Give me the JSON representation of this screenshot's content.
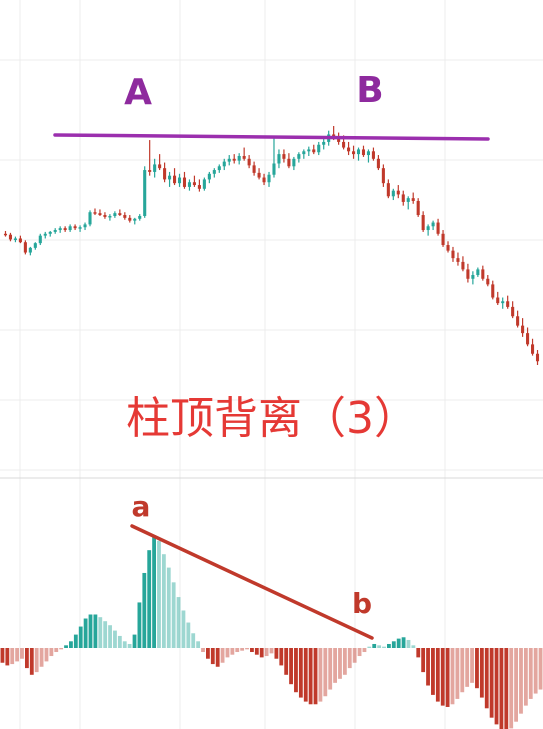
{
  "chart_data": [
    {
      "type": "candlestick",
      "annotations": {
        "peak_a_label": "A",
        "peak_b_label": "B",
        "resistance_line_color": "#9b2fae",
        "label_color": "#8e2a9e"
      },
      "colors": {
        "up": "#26a69a",
        "down": "#c0392b"
      },
      "grid": true,
      "ohlc": [
        [
          0.6,
          0.63,
          0.57,
          0.59
        ],
        [
          0.59,
          0.61,
          0.52,
          0.54
        ],
        [
          0.54,
          0.57,
          0.51,
          0.55
        ],
        [
          0.55,
          0.58,
          0.5,
          0.51
        ],
        [
          0.51,
          0.53,
          0.38,
          0.4
        ],
        [
          0.4,
          0.46,
          0.37,
          0.45
        ],
        [
          0.45,
          0.51,
          0.43,
          0.5
        ],
        [
          0.5,
          0.6,
          0.48,
          0.58
        ],
        [
          0.58,
          0.62,
          0.55,
          0.6
        ],
        [
          0.6,
          0.63,
          0.57,
          0.62
        ],
        [
          0.62,
          0.66,
          0.6,
          0.64
        ],
        [
          0.64,
          0.68,
          0.61,
          0.66
        ],
        [
          0.66,
          0.68,
          0.62,
          0.64
        ],
        [
          0.64,
          0.7,
          0.62,
          0.68
        ],
        [
          0.68,
          0.7,
          0.64,
          0.66
        ],
        [
          0.66,
          0.69,
          0.62,
          0.67
        ],
        [
          0.67,
          0.72,
          0.64,
          0.7
        ],
        [
          0.7,
          0.85,
          0.68,
          0.83
        ],
        [
          0.83,
          0.87,
          0.8,
          0.82
        ],
        [
          0.82,
          0.86,
          0.79,
          0.8
        ],
        [
          0.8,
          0.83,
          0.76,
          0.78
        ],
        [
          0.78,
          0.81,
          0.74,
          0.79
        ],
        [
          0.79,
          0.84,
          0.77,
          0.82
        ],
        [
          0.82,
          0.86,
          0.79,
          0.8
        ],
        [
          0.8,
          0.83,
          0.75,
          0.77
        ],
        [
          0.77,
          0.8,
          0.72,
          0.74
        ],
        [
          0.74,
          0.77,
          0.7,
          0.76
        ],
        [
          0.76,
          0.81,
          0.74,
          0.79
        ],
        [
          0.79,
          1.32,
          0.77,
          1.28
        ],
        [
          1.28,
          1.6,
          1.22,
          1.26
        ],
        [
          1.26,
          1.4,
          1.2,
          1.34
        ],
        [
          1.34,
          1.45,
          1.28,
          1.3
        ],
        [
          1.3,
          1.36,
          1.15,
          1.18
        ],
        [
          1.18,
          1.26,
          1.1,
          1.22
        ],
        [
          1.22,
          1.3,
          1.12,
          1.14
        ],
        [
          1.14,
          1.24,
          1.1,
          1.2
        ],
        [
          1.2,
          1.26,
          1.08,
          1.1
        ],
        [
          1.1,
          1.18,
          1.06,
          1.15
        ],
        [
          1.15,
          1.22,
          1.1,
          1.12
        ],
        [
          1.12,
          1.18,
          1.05,
          1.08
        ],
        [
          1.08,
          1.2,
          1.06,
          1.18
        ],
        [
          1.18,
          1.26,
          1.14,
          1.24
        ],
        [
          1.24,
          1.3,
          1.2,
          1.28
        ],
        [
          1.28,
          1.34,
          1.25,
          1.32
        ],
        [
          1.32,
          1.4,
          1.28,
          1.37
        ],
        [
          1.37,
          1.44,
          1.33,
          1.4
        ],
        [
          1.4,
          1.45,
          1.35,
          1.38
        ],
        [
          1.38,
          1.46,
          1.34,
          1.43
        ],
        [
          1.43,
          1.52,
          1.38,
          1.4
        ],
        [
          1.4,
          1.44,
          1.3,
          1.33
        ],
        [
          1.33,
          1.37,
          1.22,
          1.25
        ],
        [
          1.25,
          1.3,
          1.18,
          1.2
        ],
        [
          1.2,
          1.24,
          1.12,
          1.15
        ],
        [
          1.15,
          1.26,
          1.1,
          1.23
        ],
        [
          1.23,
          1.62,
          1.2,
          1.35
        ],
        [
          1.35,
          1.5,
          1.3,
          1.45
        ],
        [
          1.45,
          1.5,
          1.36,
          1.4
        ],
        [
          1.4,
          1.46,
          1.3,
          1.32
        ],
        [
          1.32,
          1.42,
          1.28,
          1.4
        ],
        [
          1.4,
          1.47,
          1.36,
          1.45
        ],
        [
          1.45,
          1.5,
          1.4,
          1.48
        ],
        [
          1.48,
          1.53,
          1.43,
          1.5
        ],
        [
          1.5,
          1.55,
          1.45,
          1.47
        ],
        [
          1.47,
          1.58,
          1.44,
          1.55
        ],
        [
          1.55,
          1.62,
          1.5,
          1.58
        ],
        [
          1.58,
          1.7,
          1.54,
          1.66
        ],
        [
          1.66,
          1.75,
          1.6,
          1.62
        ],
        [
          1.62,
          1.68,
          1.55,
          1.58
        ],
        [
          1.58,
          1.65,
          1.5,
          1.52
        ],
        [
          1.52,
          1.58,
          1.44,
          1.48
        ],
        [
          1.48,
          1.54,
          1.4,
          1.45
        ],
        [
          1.45,
          1.52,
          1.38,
          1.5
        ],
        [
          1.5,
          1.54,
          1.42,
          1.44
        ],
        [
          1.44,
          1.5,
          1.36,
          1.48
        ],
        [
          1.48,
          1.52,
          1.38,
          1.4
        ],
        [
          1.4,
          1.44,
          1.28,
          1.3
        ],
        [
          1.3,
          1.34,
          1.1,
          1.14
        ],
        [
          1.14,
          1.18,
          0.98,
          1.0
        ],
        [
          1.0,
          1.08,
          0.96,
          1.06
        ],
        [
          1.06,
          1.12,
          0.98,
          1.02
        ],
        [
          1.02,
          1.06,
          0.9,
          0.94
        ],
        [
          0.94,
          1.0,
          0.86,
          0.98
        ],
        [
          0.98,
          1.04,
          0.92,
          0.95
        ],
        [
          0.95,
          0.98,
          0.78,
          0.8
        ],
        [
          0.8,
          0.84,
          0.62,
          0.64
        ],
        [
          0.64,
          0.7,
          0.58,
          0.68
        ],
        [
          0.68,
          0.74,
          0.64,
          0.72
        ],
        [
          0.72,
          0.76,
          0.58,
          0.6
        ],
        [
          0.6,
          0.64,
          0.46,
          0.48
        ],
        [
          0.48,
          0.52,
          0.4,
          0.42
        ],
        [
          0.42,
          0.46,
          0.3,
          0.34
        ],
        [
          0.34,
          0.4,
          0.26,
          0.3
        ],
        [
          0.3,
          0.36,
          0.2,
          0.22
        ],
        [
          0.22,
          0.28,
          0.08,
          0.12
        ],
        [
          0.12,
          0.2,
          0.06,
          0.16
        ],
        [
          0.16,
          0.24,
          0.14,
          0.22
        ],
        [
          0.22,
          0.26,
          0.1,
          0.12
        ],
        [
          0.12,
          0.16,
          0.04,
          0.06
        ],
        [
          0.06,
          0.1,
          -0.1,
          -0.08
        ],
        [
          -0.08,
          -0.02,
          -0.16,
          -0.14
        ],
        [
          -0.14,
          -0.08,
          -0.2,
          -0.12
        ],
        [
          -0.12,
          -0.06,
          -0.2,
          -0.18
        ],
        [
          -0.18,
          -0.12,
          -0.3,
          -0.28
        ],
        [
          -0.28,
          -0.22,
          -0.4,
          -0.38
        ],
        [
          -0.38,
          -0.3,
          -0.5,
          -0.46
        ],
        [
          -0.46,
          -0.4,
          -0.6,
          -0.58
        ],
        [
          -0.58,
          -0.52,
          -0.7,
          -0.68
        ],
        [
          -0.68,
          -0.64,
          -0.8,
          -0.76
        ]
      ]
    },
    {
      "type": "bar",
      "subtype": "macd-histogram",
      "annotations": {
        "peak_a_label": "a",
        "peak_b_label": "b",
        "divergence_line_color": "#c0392b"
      },
      "colors": {
        "positive": "#26a69a",
        "negative": "#c0392b"
      },
      "grid": true,
      "values": [
        -0.22,
        -0.26,
        -0.24,
        -0.2,
        -0.16,
        -0.3,
        -0.4,
        -0.36,
        -0.28,
        -0.2,
        -0.12,
        -0.06,
        -0.02,
        0.04,
        0.1,
        0.2,
        0.32,
        0.44,
        0.5,
        0.5,
        0.46,
        0.4,
        0.34,
        0.26,
        0.18,
        0.1,
        0.06,
        0.2,
        0.68,
        1.12,
        1.46,
        1.68,
        1.6,
        1.4,
        1.2,
        0.98,
        0.76,
        0.56,
        0.38,
        0.22,
        0.1,
        -0.06,
        -0.16,
        -0.24,
        -0.28,
        -0.22,
        -0.14,
        -0.1,
        -0.06,
        -0.04,
        -0.02,
        -0.06,
        -0.1,
        -0.14,
        -0.12,
        -0.08,
        -0.16,
        -0.26,
        -0.4,
        -0.54,
        -0.66,
        -0.74,
        -0.8,
        -0.84,
        -0.84,
        -0.8,
        -0.72,
        -0.62,
        -0.52,
        -0.46,
        -0.4,
        -0.3,
        -0.22,
        -0.12,
        -0.06,
        0.02,
        0.06,
        0.04,
        0.02,
        0.06,
        0.1,
        0.14,
        0.16,
        0.12,
        0.04,
        -0.14,
        -0.36,
        -0.56,
        -0.7,
        -0.8,
        -0.86,
        -0.88,
        -0.84,
        -0.76,
        -0.66,
        -0.58,
        -0.52,
        -0.6,
        -0.74,
        -0.9,
        -1.04,
        -1.14,
        -1.22,
        -1.26,
        -1.2,
        -1.1,
        -0.98,
        -0.86,
        -0.76,
        -0.68,
        -0.62
      ]
    }
  ],
  "title_text": "柱顶背离（3）",
  "title_color": "#e53935"
}
